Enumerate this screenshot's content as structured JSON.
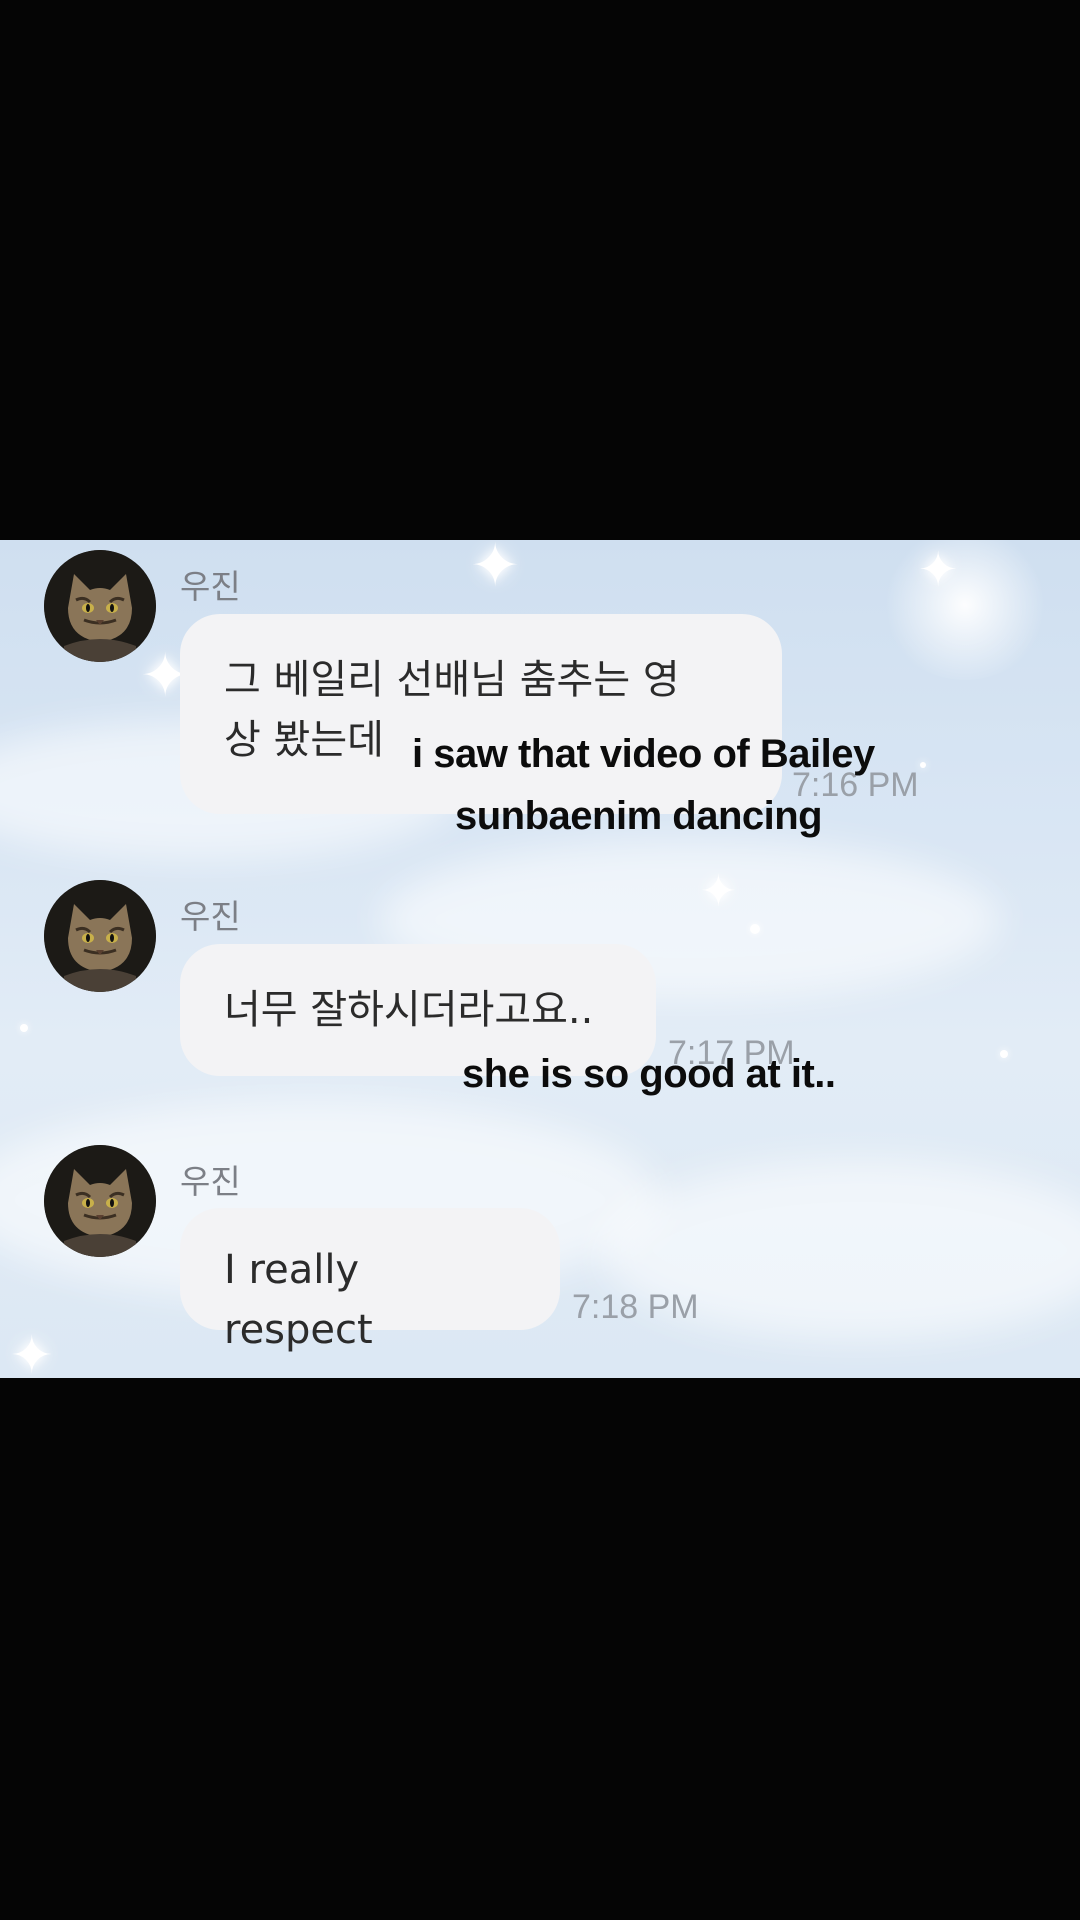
{
  "messages": [
    {
      "sender": "우진",
      "avatar_icon": "cat-avatar",
      "text_line1": "그 베일리 선배님 춤추는 영",
      "text_line2": "상 봤는데",
      "time": "7:16 PM",
      "caption_line1": "i saw that video of Bailey",
      "caption_line2": "sunbaenim dancing"
    },
    {
      "sender": "우진",
      "avatar_icon": "cat-avatar",
      "text": "너무 잘하시더라고요..",
      "time": "7:17 PM",
      "caption": "she is so good at it.."
    },
    {
      "sender": "우진",
      "avatar_icon": "cat-avatar",
      "text": "I really respect",
      "time": "7:18 PM"
    }
  ],
  "colors": {
    "letterbox": "#050505",
    "bubble": "#f3f3f5",
    "sender_text": "#7c7f86",
    "time_text": "#9aa0a8",
    "caption_text": "#0c0c0c"
  }
}
